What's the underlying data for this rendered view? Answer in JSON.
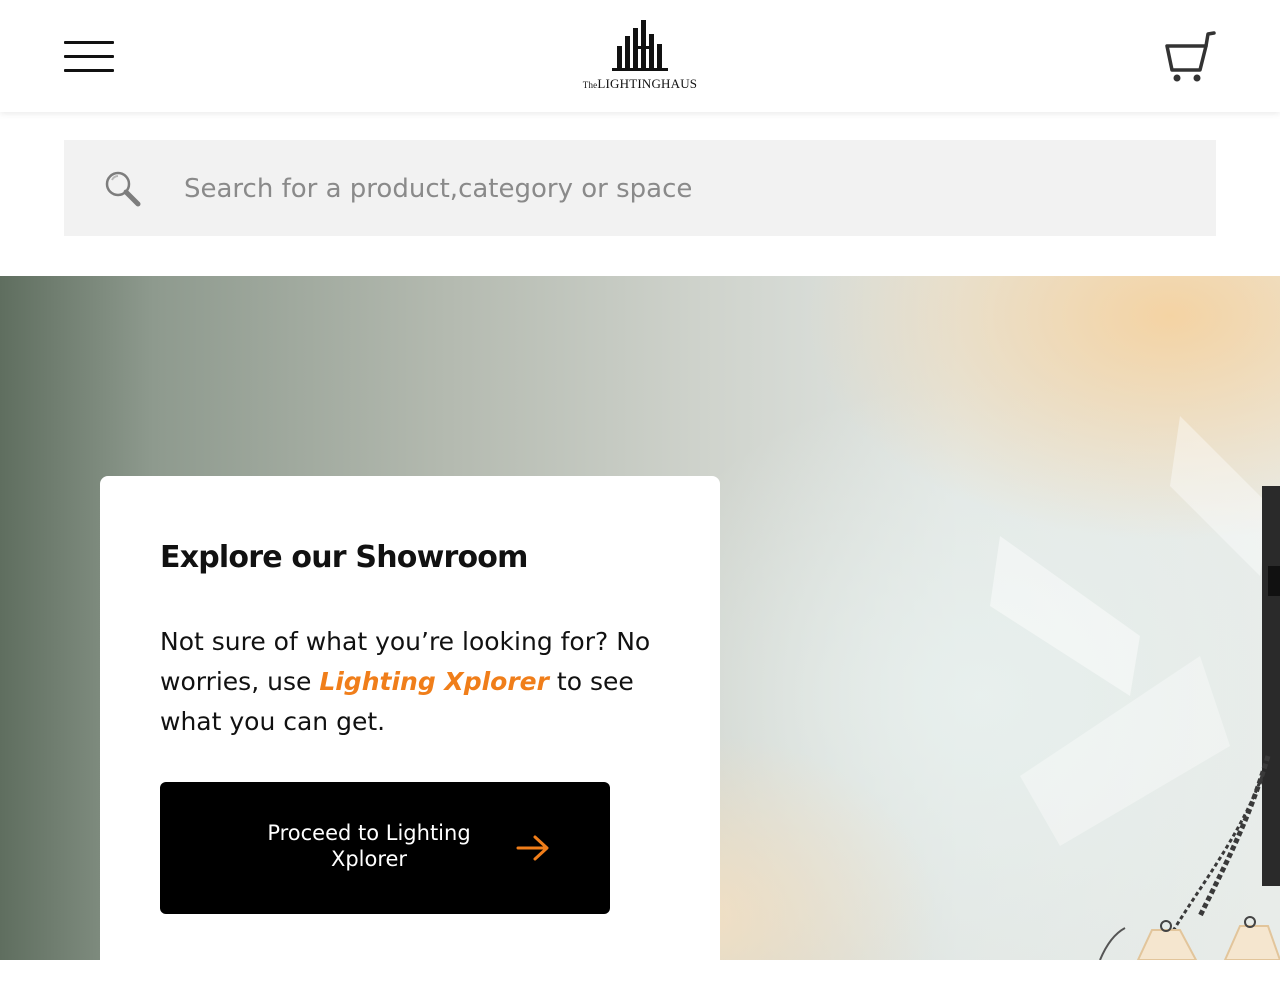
{
  "header": {
    "logo": {
      "prefix": "The",
      "brand": "LIGHTINGHAUS"
    },
    "menu_icon": "hamburger-menu-icon",
    "cart_icon": "shopping-cart-icon"
  },
  "search": {
    "placeholder": "Search for a product,category or space",
    "value": "",
    "icon": "magnifier-icon"
  },
  "showroom": {
    "title": "Explore our Showroom",
    "body_start": "Not sure of what you’re looking for? No worries, use ",
    "link_text": "Lighting Xplorer",
    "body_end": " to see what you can get.",
    "cta_label": "Proceed to Lighting Xplorer",
    "cta_icon": "arrow-right-icon"
  },
  "colors": {
    "accent": "#f07e1a",
    "button_bg": "#000000",
    "search_bg": "#f2f2f2",
    "text": "#111111"
  }
}
